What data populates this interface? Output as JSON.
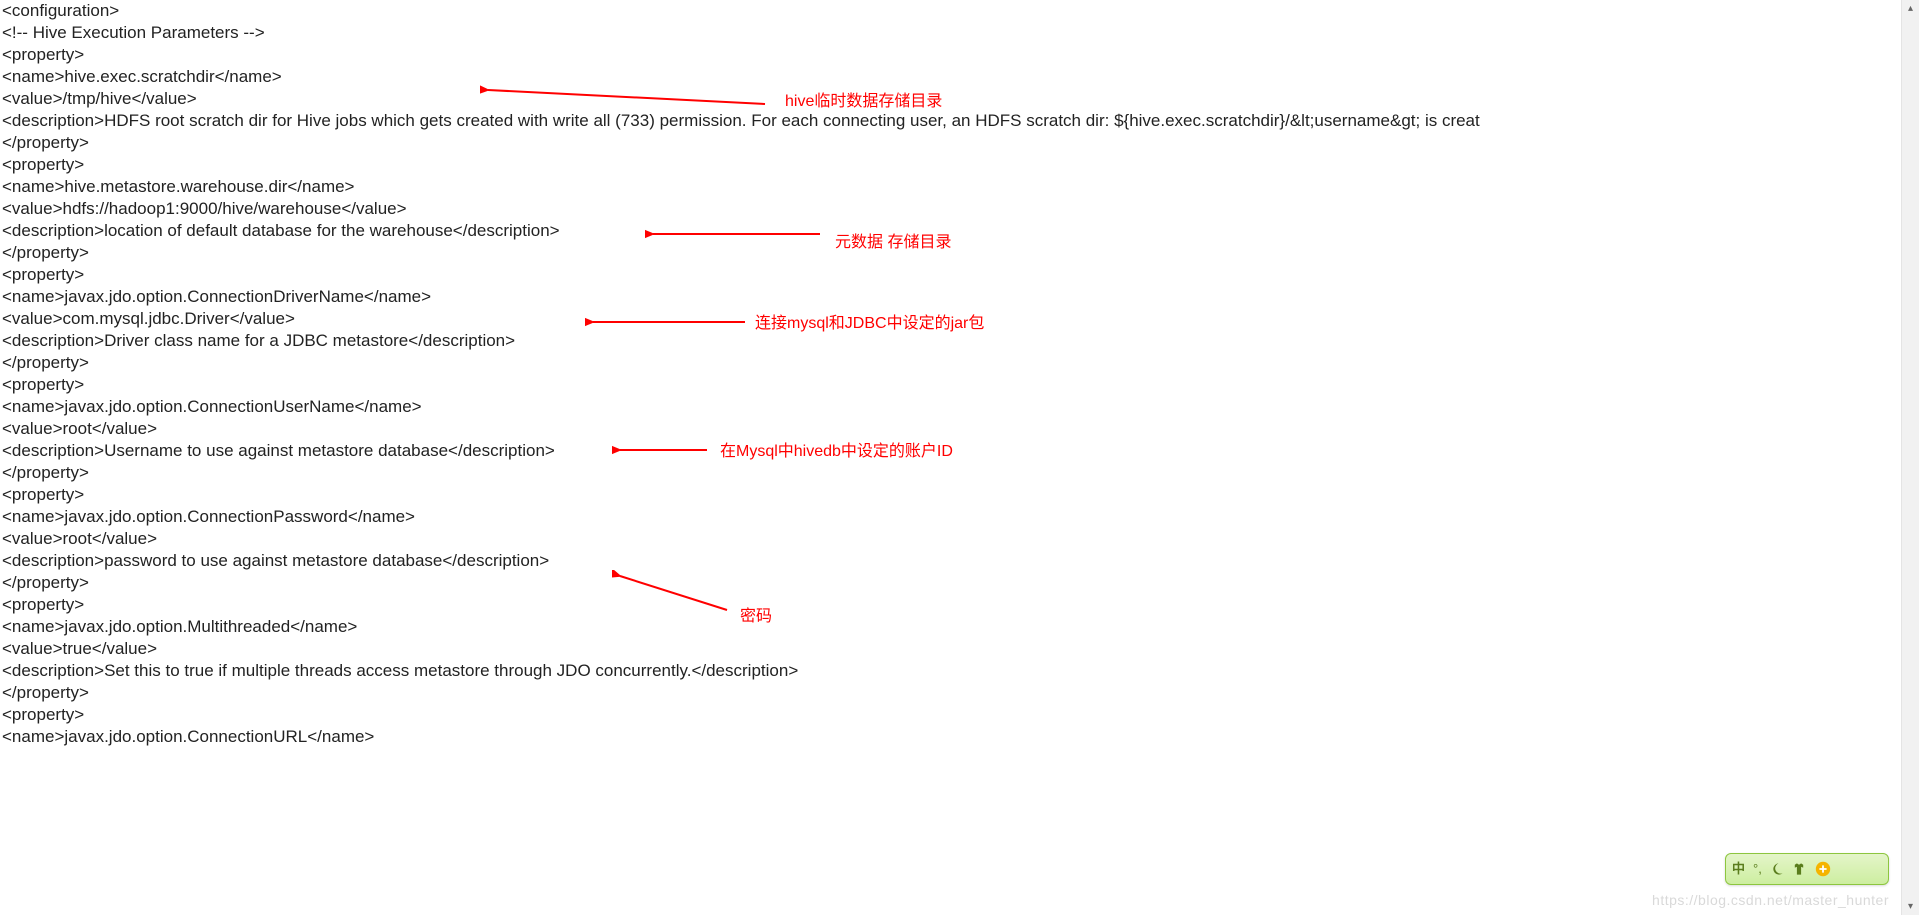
{
  "code": {
    "l0": "<configuration>",
    "l1": "  <!-- Hive Execution Parameters -->",
    "l2": "  <property>",
    "l3": "    <name>hive.exec.scratchdir</name>",
    "l4": "    <value>/tmp/hive</value>",
    "l5": "    <description>HDFS root scratch dir for Hive jobs which gets created with write all (733) permission. For each connecting user, an HDFS scratch dir: ${hive.exec.scratchdir}/&lt;username&gt; is creat",
    "l6": "  </property>",
    "l7": "  <property>",
    "l8": "    <name>hive.metastore.warehouse.dir</name>",
    "l9": "    <value>hdfs://hadoop1:9000/hive/warehouse</value>",
    "l10": "    <description>location of default database for the warehouse</description>",
    "l11": "  </property>",
    "l12": "  <property>",
    "l13": "    <name>javax.jdo.option.ConnectionDriverName</name>",
    "l14": "    <value>com.mysql.jdbc.Driver</value>",
    "l15": "    <description>Driver class name for a JDBC metastore</description>",
    "l16": "  </property>",
    "l17": "  <property>",
    "l18": "<name>javax.jdo.option.ConnectionUserName</name>",
    "l19": "    <value>root</value>",
    "l20": "    <description>Username to use against metastore database</description>",
    "l21": "  </property>",
    "l22": "  <property>",
    "l23": "    <name>javax.jdo.option.ConnectionPassword</name>",
    "l24": "    <value>root</value>",
    "l25": "    <description>password to use against metastore database</description>",
    "l26": "  </property>",
    "l27": "  <property>",
    "l28": "    <name>javax.jdo.option.Multithreaded</name>",
    "l29": "    <value>true</value>",
    "l30": "    <description>Set this to true if multiple threads access metastore through JDO concurrently.</description>",
    "l31": "  </property>",
    "l32": "  <property>",
    "l33": "    <name>javax.jdo.option.ConnectionURL</name>"
  },
  "annotations": {
    "a1": "hive临时数据存储目录",
    "a2": "元数据 存储目录",
    "a3": "连接mysql和JDBC中设定的jar包",
    "a4": "在Mysql中hivedb中设定的账户ID",
    "a5": "密码"
  },
  "ime": {
    "label": "中"
  },
  "watermark": "https://blog.csdn.net/master_hunter"
}
